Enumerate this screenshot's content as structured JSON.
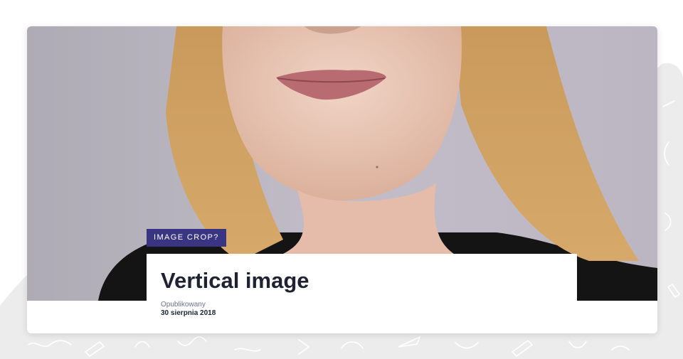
{
  "article": {
    "tag": "IMAGE CROP?",
    "title": "Vertical image",
    "published_label": "Opublikowany",
    "published_date": "30 sierpnia 2018"
  },
  "image": {
    "subject": "portrait photo of a woman with long blonde hair, cropped at the mouth"
  },
  "colors": {
    "tag_background": "#3a3583",
    "title_text": "#1e2233",
    "label_text": "#6b7191",
    "photo_background": "#b9b4bf"
  }
}
